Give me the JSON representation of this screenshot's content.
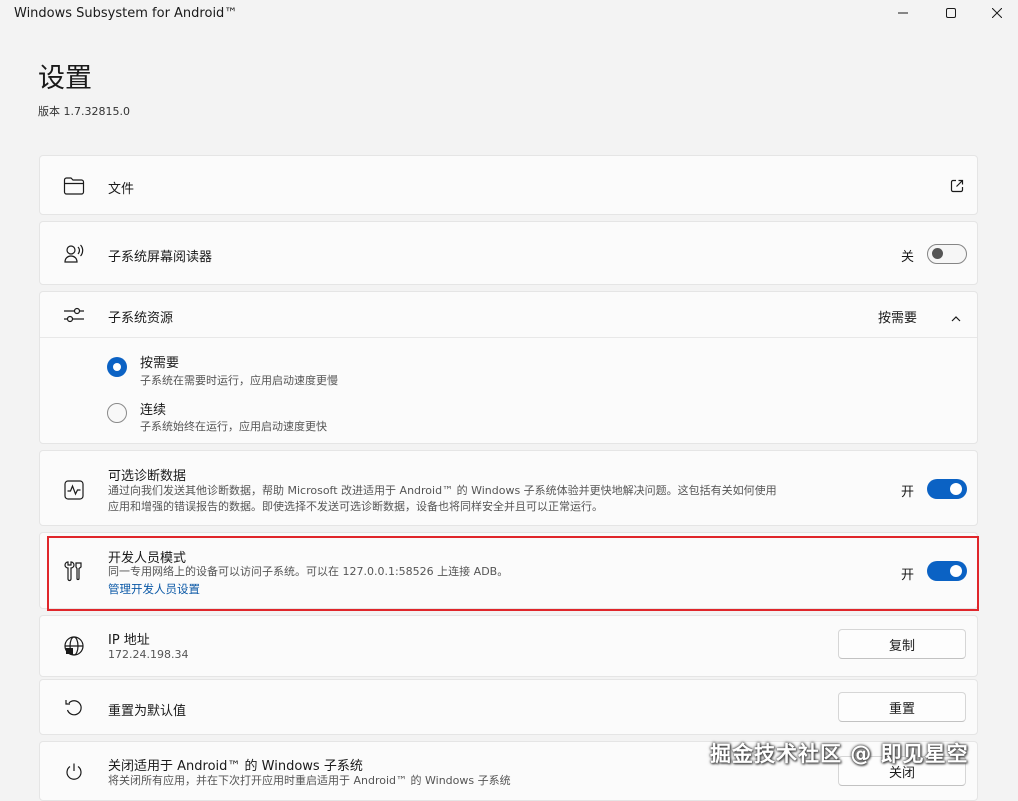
{
  "window": {
    "title": "Windows Subsystem for Android™"
  },
  "page": {
    "title": "设置",
    "version": "版本 1.7.32815.0"
  },
  "files": {
    "label": "文件"
  },
  "screen_reader": {
    "label": "子系统屏幕阅读器",
    "state": "关"
  },
  "resources": {
    "label": "子系统资源",
    "selected": "按需要",
    "options": [
      {
        "label": "按需要",
        "desc": "子系统在需要时运行，应用启动速度更慢"
      },
      {
        "label": "连续",
        "desc": "子系统始终在运行，应用启动速度更快"
      }
    ]
  },
  "diagnostics": {
    "label": "可选诊断数据",
    "desc_line1": "通过向我们发送其他诊断数据，帮助 Microsoft 改进适用于 Android™ 的 Windows 子系统体验并更快地解决问题。这包括有关如何使用",
    "desc_line2": "应用和增强的错误报告的数据。即使选择不发送可选诊断数据，设备也将同样安全并且可以正常运行。",
    "state": "开"
  },
  "developer": {
    "label": "开发人员模式",
    "desc": "同一专用网络上的设备可以访问子系统。可以在 127.0.0.1:58526 上连接 ADB。",
    "link": "管理开发人员设置",
    "state": "开"
  },
  "ip": {
    "label": "IP 地址",
    "value": "172.24.198.34",
    "button": "复制"
  },
  "reset": {
    "label": "重置为默认值",
    "button": "重置"
  },
  "shutdown": {
    "label": "关闭适用于 Android™ 的 Windows 子系统",
    "desc": "将关闭所有应用，并在下次打开应用时重启适用于 Android™ 的 Windows 子系统",
    "button": "关闭"
  },
  "watermark": "掘金技术社区 @ 即见星空",
  "colors": {
    "accent": "#0b62c4",
    "link": "#0d5aa7",
    "highlight": "#e0262b",
    "background": "#f3f3f3"
  }
}
